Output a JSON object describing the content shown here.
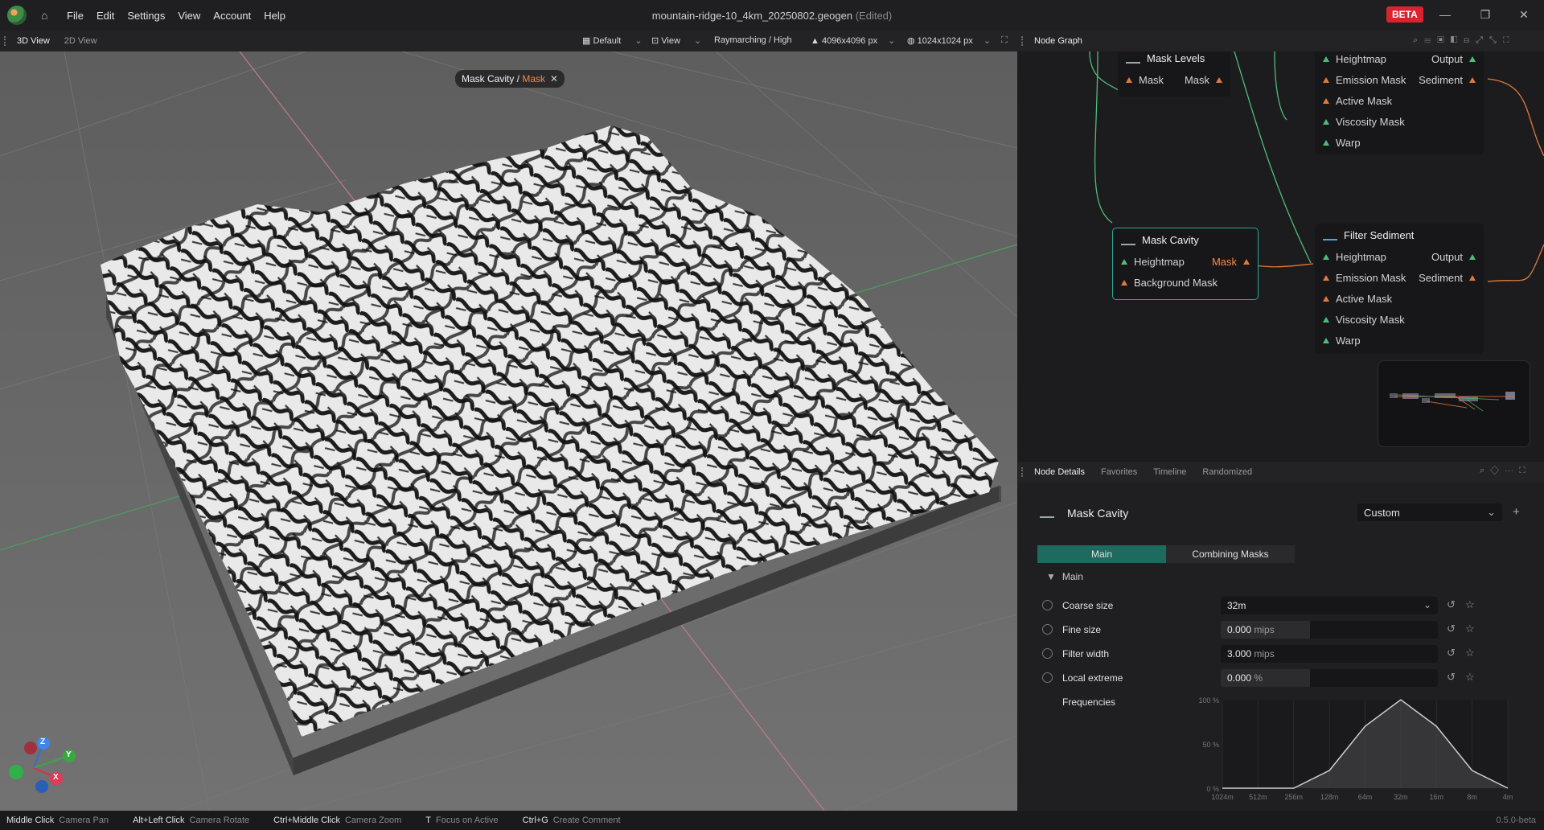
{
  "titlebar": {
    "menus": [
      "File",
      "Edit",
      "Settings",
      "View",
      "Account",
      "Help"
    ],
    "doc_title": "mountain-ridge-10_4km_20250802.geogen",
    "edited": "(Edited)",
    "beta": "BETA"
  },
  "viewport": {
    "tabs": [
      "3D View",
      "2D View"
    ],
    "toolbar": {
      "preset": "Default",
      "view": "View",
      "render": "Raymarching / High",
      "resolution": "4096x4096 px",
      "preview": "1024x1024 px"
    },
    "chip": {
      "node": "Mask Cavity",
      "sep": " / ",
      "port": "Mask"
    },
    "axes": {
      "x": "X",
      "y": "Y",
      "z": "Z"
    }
  },
  "node_graph": {
    "tab": "Node Graph",
    "nodes": {
      "mask_levels": {
        "title": "Mask Levels",
        "in": "Mask",
        "out": "Mask"
      },
      "filter_top": {
        "ports": [
          "Heightmap",
          "Emission Mask",
          "Active Mask",
          "Viscosity Mask",
          "Warp"
        ],
        "outs": [
          "Output",
          "Sediment"
        ]
      },
      "mask_cavity": {
        "title": "Mask Cavity",
        "ports": [
          "Heightmap",
          "Background Mask"
        ],
        "out": "Mask"
      },
      "filter_sediment": {
        "title": "Filter Sediment",
        "ports": [
          "Heightmap",
          "Emission Mask",
          "Active Mask",
          "Viscosity Mask",
          "Warp"
        ],
        "outs": [
          "Output",
          "Sediment"
        ]
      }
    }
  },
  "details": {
    "tabs": [
      "Node Details",
      "Favorites",
      "Timeline",
      "Randomized"
    ],
    "title": "Mask Cavity",
    "preset": "Custom",
    "subtabs": [
      "Main",
      "Combining Masks"
    ],
    "section": "Main",
    "params": [
      {
        "label": "Coarse size",
        "value": "32m",
        "unit": "",
        "fill": 0
      },
      {
        "label": "Fine size",
        "value": "0.000",
        "unit": "mips",
        "fill": 0.41
      },
      {
        "label": "Filter width",
        "value": "3.000",
        "unit": "mips",
        "fill": 0
      },
      {
        "label": "Local extreme",
        "value": "0.000",
        "unit": "%",
        "fill": 0.41
      }
    ],
    "frequencies": {
      "label": "Frequencies",
      "y_ticks": [
        "100 %",
        "50 %",
        "0 %"
      ],
      "x_ticks": [
        "1024m",
        "512m",
        "256m",
        "128m",
        "64m",
        "32m",
        "16m",
        "8m",
        "4m"
      ],
      "values": [
        0,
        0,
        0,
        20,
        70,
        100,
        70,
        20,
        0
      ]
    }
  },
  "statusbar": {
    "hints": [
      {
        "key": "Middle Click",
        "desc": "Camera Pan"
      },
      {
        "key": "Alt+Left Click",
        "desc": "Camera Rotate"
      },
      {
        "key": "Ctrl+Middle Click",
        "desc": "Camera Zoom"
      },
      {
        "key": "T",
        "desc": "Focus on Active"
      },
      {
        "key": "Ctrl+G",
        "desc": "Create Comment"
      }
    ],
    "version": "0.5.0-beta"
  },
  "colors": {
    "accent_orange": "#f08a4b",
    "accent_teal": "#1d6a5e",
    "beta_red": "#d9232f",
    "port_green": "#4ebd7a"
  }
}
